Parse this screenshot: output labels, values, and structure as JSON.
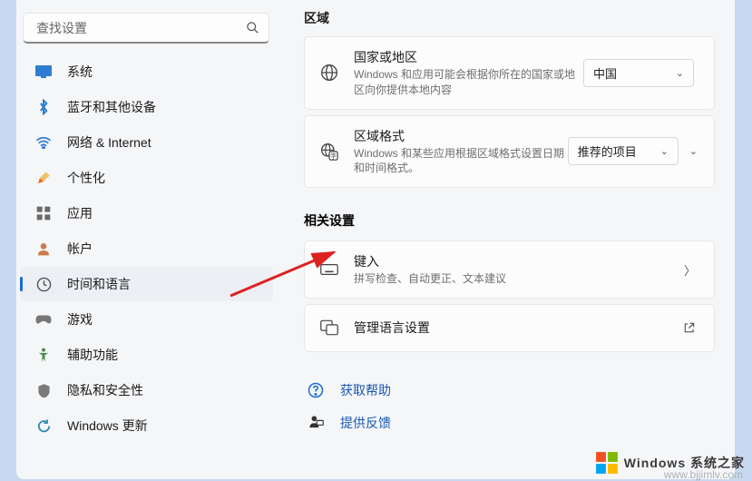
{
  "search": {
    "placeholder": "查找设置"
  },
  "sidebar": {
    "items": [
      {
        "label": "系统",
        "icon": "system"
      },
      {
        "label": "蓝牙和其他设备",
        "icon": "bluetooth"
      },
      {
        "label": "网络 & Internet",
        "icon": "network"
      },
      {
        "label": "个性化",
        "icon": "personalize"
      },
      {
        "label": "应用",
        "icon": "apps"
      },
      {
        "label": "帐户",
        "icon": "accounts"
      },
      {
        "label": "时间和语言",
        "icon": "time"
      },
      {
        "label": "游戏",
        "icon": "gaming"
      },
      {
        "label": "辅助功能",
        "icon": "accessibility"
      },
      {
        "label": "隐私和安全性",
        "icon": "privacy"
      },
      {
        "label": "Windows 更新",
        "icon": "update"
      }
    ],
    "active_index": 6
  },
  "region": {
    "heading": "区域",
    "country": {
      "title": "国家或地区",
      "desc": "Windows 和应用可能会根据你所在的国家或地区向你提供本地内容",
      "value": "中国"
    },
    "format": {
      "title": "区域格式",
      "desc": "Windows 和某些应用根据区域格式设置日期和时间格式。",
      "value": "推荐的项目"
    }
  },
  "related": {
    "heading": "相关设置",
    "typing": {
      "title": "键入",
      "desc": "拼写检查、自动更正、文本建议"
    },
    "language": {
      "title": "管理语言设置"
    }
  },
  "links": {
    "help": "获取帮助",
    "feedback": "提供反馈"
  },
  "watermark": {
    "brand": "Windows",
    "suffix": "系统之家",
    "url": "www.bjjimlv.com"
  }
}
